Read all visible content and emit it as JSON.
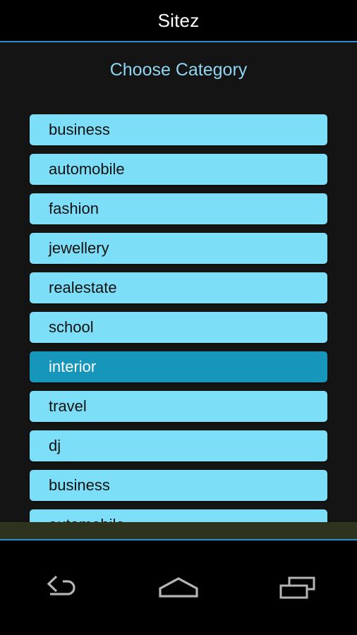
{
  "app": {
    "title": "Sitez",
    "heading": "Choose Category"
  },
  "colors": {
    "accent_blue": "#2a8fd0",
    "item_bg": "#7ddff7",
    "item_selected_bg": "#1696bb",
    "heading_text": "#8ed5f0",
    "screen_bg": "#141414",
    "titlebar_bg": "#000000",
    "item_text": "#111111",
    "item_selected_text": "#ffffff",
    "band": "#2e3320"
  },
  "categories": [
    {
      "label": "business",
      "selected": false
    },
    {
      "label": "automobile",
      "selected": false
    },
    {
      "label": "fashion",
      "selected": false
    },
    {
      "label": "jewellery",
      "selected": false
    },
    {
      "label": "realestate",
      "selected": false
    },
    {
      "label": "school",
      "selected": false
    },
    {
      "label": "interior",
      "selected": true
    },
    {
      "label": "travel",
      "selected": false
    },
    {
      "label": "dj",
      "selected": false
    },
    {
      "label": "business",
      "selected": false
    },
    {
      "label": "automobile",
      "selected": false
    }
  ],
  "navbar": {
    "back": "back-icon",
    "home": "home-icon",
    "recents": "recents-icon"
  }
}
